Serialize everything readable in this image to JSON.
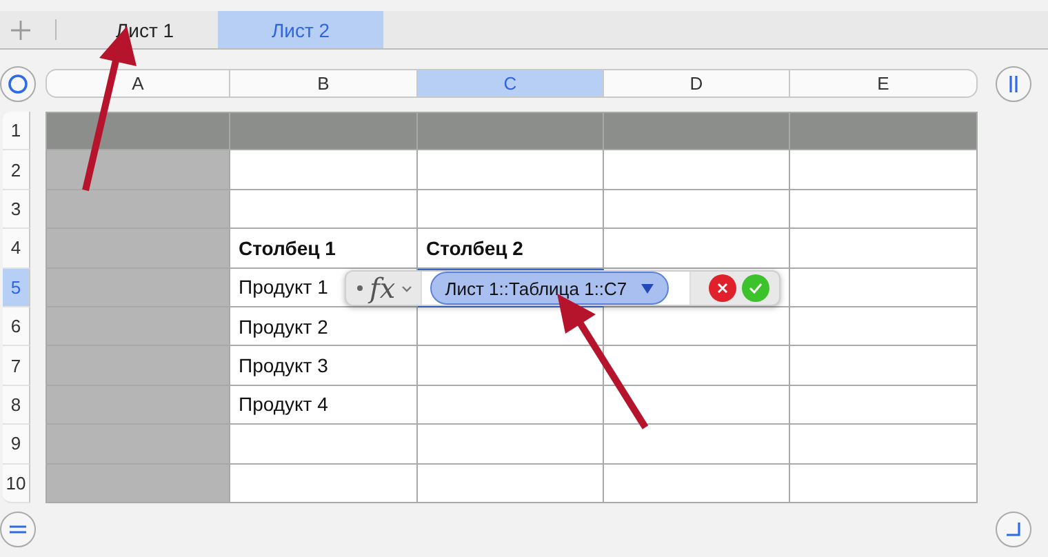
{
  "tabs": [
    {
      "label": "Лист 1",
      "selected": false
    },
    {
      "label": "Лист 2",
      "selected": true
    }
  ],
  "columns": [
    {
      "label": "A",
      "selected": false,
      "kind": "header"
    },
    {
      "label": "B",
      "selected": false,
      "kind": "body"
    },
    {
      "label": "C",
      "selected": true,
      "kind": "body"
    },
    {
      "label": "D",
      "selected": false,
      "kind": "body"
    },
    {
      "label": "E",
      "selected": false,
      "kind": "body"
    }
  ],
  "rows": [
    {
      "label": "1",
      "kind": "header",
      "selected": false,
      "cells": [
        {
          "selected": false
        },
        {
          "selected": false
        },
        {
          "selected": false
        },
        {
          "selected": false
        },
        {
          "selected": false
        }
      ]
    },
    {
      "label": "2",
      "kind": "body",
      "selected": false,
      "cells": [
        {
          "selected": false
        },
        {
          "selected": false
        },
        {
          "selected": false
        },
        {
          "selected": false
        },
        {
          "selected": false
        }
      ]
    },
    {
      "label": "3",
      "kind": "body",
      "selected": false,
      "cells": [
        {
          "selected": false
        },
        {
          "selected": false
        },
        {
          "selected": false
        },
        {
          "selected": false
        },
        {
          "selected": false
        }
      ]
    },
    {
      "label": "4",
      "kind": "body",
      "selected": false,
      "cells": [
        {
          "selected": false
        },
        {
          "text": "Столбец 1",
          "bold": true,
          "selected": false
        },
        {
          "text": "Столбец 2",
          "bold": true,
          "selected": false
        },
        {
          "selected": false
        },
        {
          "selected": false
        }
      ]
    },
    {
      "label": "5",
      "kind": "body",
      "selected": true,
      "cells": [
        {
          "selected": false
        },
        {
          "text": "Продукт 1",
          "bold": false,
          "selected": false
        },
        {
          "selected": true
        },
        {
          "selected": false
        },
        {
          "selected": false
        }
      ]
    },
    {
      "label": "6",
      "kind": "body",
      "selected": false,
      "cells": [
        {
          "selected": false
        },
        {
          "text": "Продукт 2",
          "bold": false,
          "selected": false
        },
        {
          "selected": false
        },
        {
          "selected": false
        },
        {
          "selected": false
        }
      ]
    },
    {
      "label": "7",
      "kind": "body",
      "selected": false,
      "cells": [
        {
          "selected": false
        },
        {
          "text": "Продукт 3",
          "bold": false,
          "selected": false
        },
        {
          "selected": false
        },
        {
          "selected": false
        },
        {
          "selected": false
        }
      ]
    },
    {
      "label": "8",
      "kind": "body",
      "selected": false,
      "cells": [
        {
          "selected": false
        },
        {
          "text": "Продукт 4",
          "bold": false,
          "selected": false
        },
        {
          "selected": false
        },
        {
          "selected": false
        },
        {
          "selected": false
        }
      ]
    },
    {
      "label": "9",
      "kind": "body",
      "selected": false,
      "cells": [
        {
          "selected": false
        },
        {
          "selected": false
        },
        {
          "selected": false
        },
        {
          "selected": false
        },
        {
          "selected": false
        }
      ]
    },
    {
      "label": "10",
      "kind": "body",
      "selected": false,
      "cells": [
        {
          "selected": false
        },
        {
          "selected": false
        },
        {
          "selected": false
        },
        {
          "selected": false
        },
        {
          "selected": false
        }
      ]
    }
  ],
  "formula_editor": {
    "function_label": "fx",
    "reference": "Лист 1::Таблица 1::C7"
  }
}
